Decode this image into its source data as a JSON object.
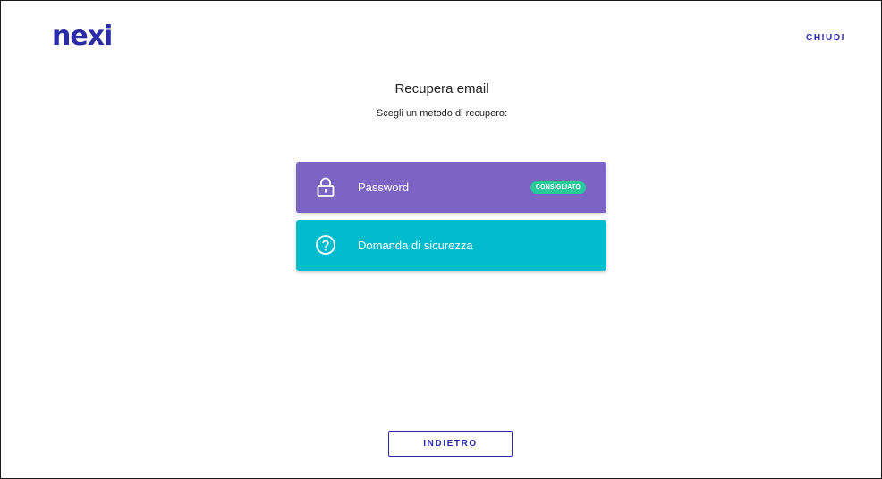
{
  "header": {
    "logo_text": "nexi",
    "close_label": "CHIUDI"
  },
  "main": {
    "title": "Recupera email",
    "subtitle": "Scegli un metodo di recupero:",
    "methods": [
      {
        "label": "Password",
        "icon": "lock-icon",
        "badge": "CONSIGLIATO",
        "color": "#7b64c4",
        "badge_color": "#28c99a"
      },
      {
        "label": "Domanda di sicurezza",
        "icon": "question-circle-icon",
        "color": "#00bccd"
      }
    ]
  },
  "footer": {
    "back_label": "INDIETRO"
  },
  "colors": {
    "brand": "#2b2ba8"
  }
}
